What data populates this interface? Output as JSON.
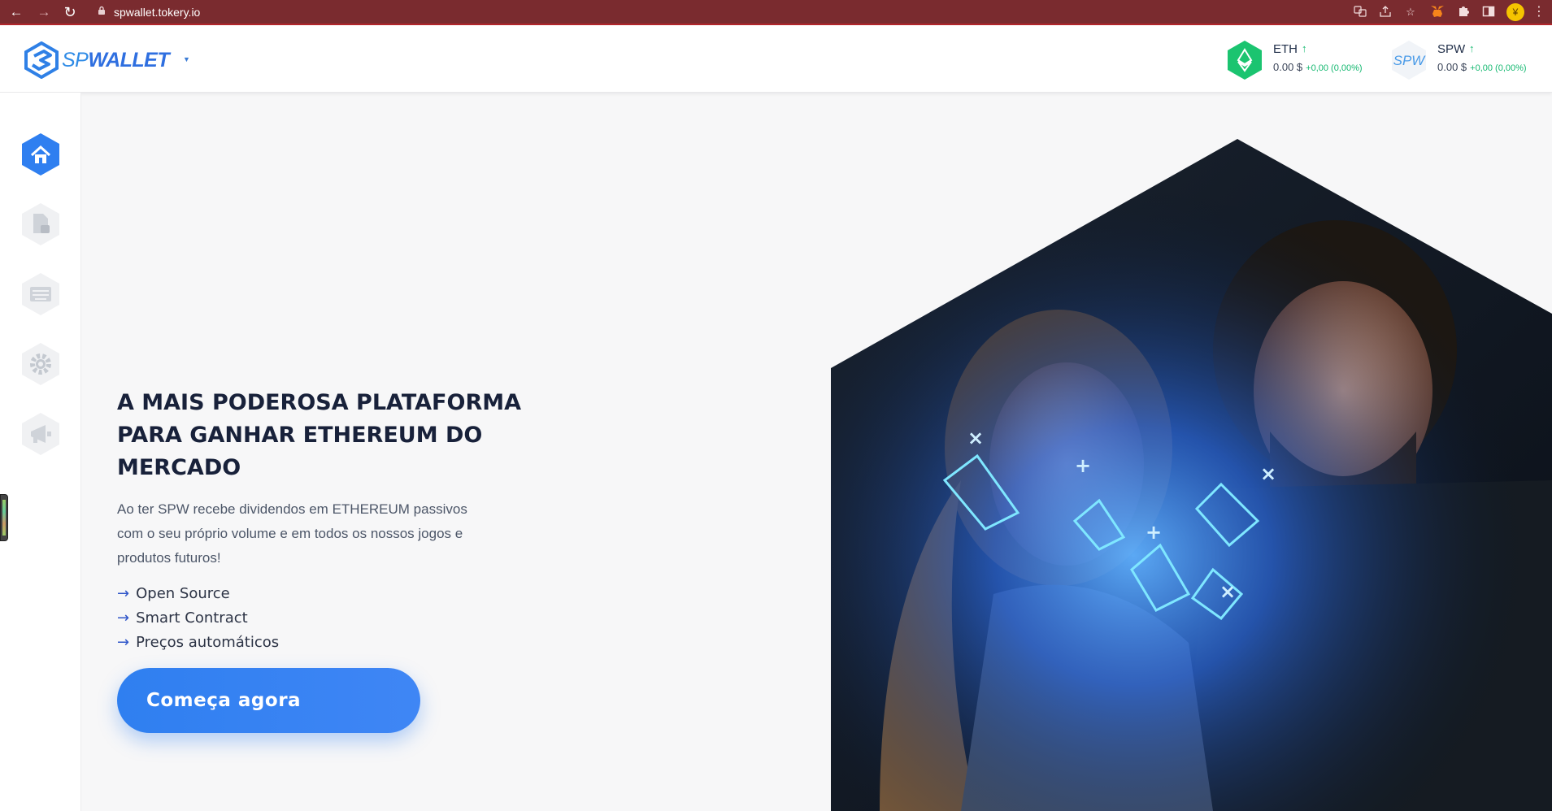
{
  "browser": {
    "url": "spwallet.tokery.io"
  },
  "header": {
    "logo_sp": "SP",
    "logo_wallet": "WALLET",
    "tickers": [
      {
        "symbol": "ETH",
        "price": "0.00 $",
        "change": "+0,00 (0,00%)"
      },
      {
        "symbol": "SPW",
        "price": "0.00 $",
        "change": "+0,00 (0,00%)",
        "badge_text": "SPW"
      }
    ]
  },
  "sidebar": {
    "items": [
      {
        "icon": "home-icon",
        "active": true
      },
      {
        "icon": "document-icon",
        "active": false
      },
      {
        "icon": "keyboard-icon",
        "active": false
      },
      {
        "icon": "gear-icon",
        "active": false
      },
      {
        "icon": "megaphone-icon",
        "active": false
      }
    ]
  },
  "hero": {
    "title_line1": "A MAIS PODEROSA PLATAFORMA",
    "title_line2": "PARA GANHAR ETHEREUM DO",
    "title_line3": "MERCADO",
    "description": "Ao ter SPW recebe dividendos em ETHEREUM passivos com o seu próprio volume e em todos os nossos jogos e produtos futuros!",
    "features": [
      "Open Source",
      "Smart Contract",
      "Preços automáticos"
    ],
    "feature_arrow": "→",
    "cta_label": "Começa agora"
  },
  "colors": {
    "accent": "#2f7ff0",
    "up": "#14b870",
    "title": "#18213a"
  }
}
